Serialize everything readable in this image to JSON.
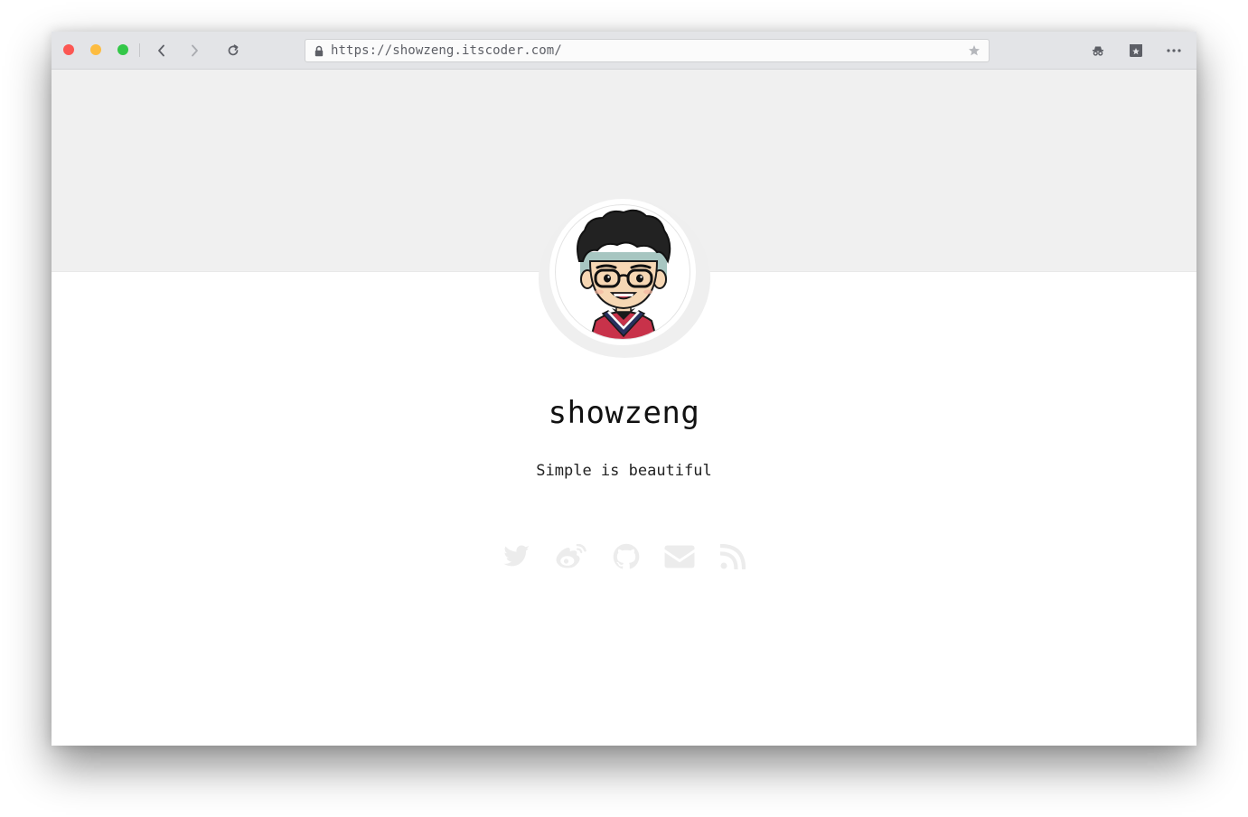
{
  "browser": {
    "url": "https://showzeng.itscoder.com/",
    "icons": {
      "back": "chevron-left-icon",
      "forward": "chevron-right-icon",
      "reload": "reload-icon",
      "lock": "lock-icon",
      "bookmark": "star-icon",
      "incognito": "incognito-icon",
      "reading_list": "bookmark-star-icon",
      "menu": "more-dots-icon"
    },
    "colors": {
      "close": "#fc5753",
      "minimize": "#fdbc40",
      "maximize": "#33c748",
      "toolbar": "#e3e4e7"
    }
  },
  "profile": {
    "name": "showzeng",
    "tagline": "Simple is beautiful",
    "avatar": "cartoon-avatar-glasses"
  },
  "social": {
    "items": [
      {
        "name": "twitter",
        "icon": "twitter-icon"
      },
      {
        "name": "weibo",
        "icon": "weibo-icon"
      },
      {
        "name": "github",
        "icon": "github-icon"
      },
      {
        "name": "email",
        "icon": "mail-icon"
      },
      {
        "name": "rss",
        "icon": "rss-icon"
      }
    ],
    "icon_color": "#ececec"
  },
  "page": {
    "banner_color": "#f0f0f0",
    "background": "#ffffff"
  }
}
